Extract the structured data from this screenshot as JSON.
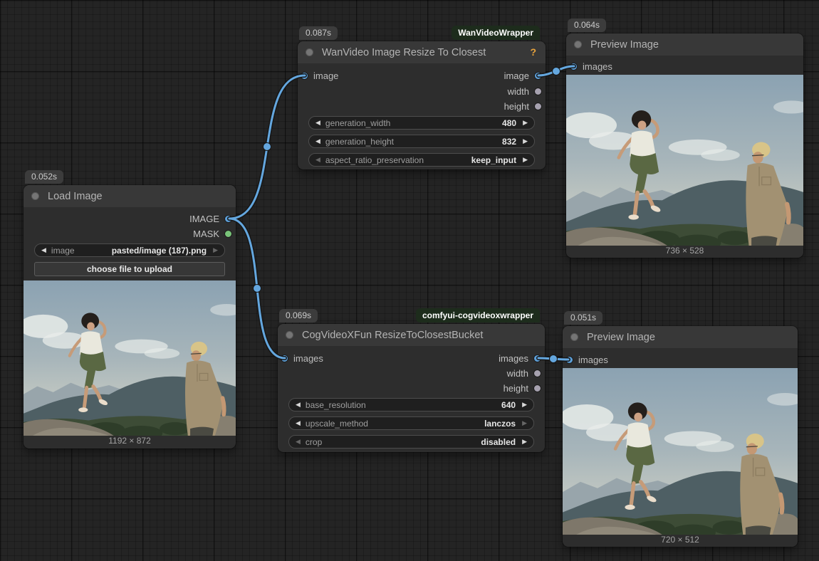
{
  "icons": {
    "arrow_left": "◀",
    "arrow_right": "▶",
    "help": "?"
  },
  "colors": {
    "link": "#64a7df",
    "slot_image": "#5d9fd8",
    "slot_mask": "#79c379",
    "slot_number": "#a6a1af",
    "module_badge_bg": "#1d2c1c",
    "help_icon": "#e8a33c"
  },
  "nodes": {
    "load_image": {
      "timing": "0.052s",
      "title": "Load Image",
      "outputs": [
        {
          "label": "IMAGE"
        },
        {
          "label": "MASK"
        }
      ],
      "widget": {
        "name": "image",
        "value": "pasted/image (187).png"
      },
      "button_label": "choose file to upload",
      "caption": "1192 × 872"
    },
    "wan_resize": {
      "timing": "0.087s",
      "module_badge": "WanVideoWrapper",
      "title": "WanVideo Image Resize To Closest",
      "input_label": "image",
      "outputs": [
        {
          "label": "image"
        },
        {
          "label": "width"
        },
        {
          "label": "height"
        }
      ],
      "widgets": [
        {
          "name": "generation_width",
          "value": "480"
        },
        {
          "name": "generation_height",
          "value": "832"
        },
        {
          "name": "aspect_ratio_preservation",
          "value": "keep_input"
        }
      ]
    },
    "preview_top": {
      "timing": "0.064s",
      "title": "Preview Image",
      "input_label": "images",
      "caption": "736 × 528"
    },
    "cog_resize": {
      "timing": "0.069s",
      "module_badge": "comfyui-cogvideoxwrapper",
      "title": "CogVideoXFun ResizeToClosestBucket",
      "input_label": "images",
      "outputs": [
        {
          "label": "images"
        },
        {
          "label": "width"
        },
        {
          "label": "height"
        }
      ],
      "widgets": [
        {
          "name": "base_resolution",
          "value": "640"
        },
        {
          "name": "upscale_method",
          "value": "lanczos"
        },
        {
          "name": "crop",
          "value": "disabled"
        }
      ]
    },
    "preview_bottom": {
      "timing": "0.051s",
      "title": "Preview Image",
      "input_label": "images",
      "caption": "720 × 512"
    }
  }
}
